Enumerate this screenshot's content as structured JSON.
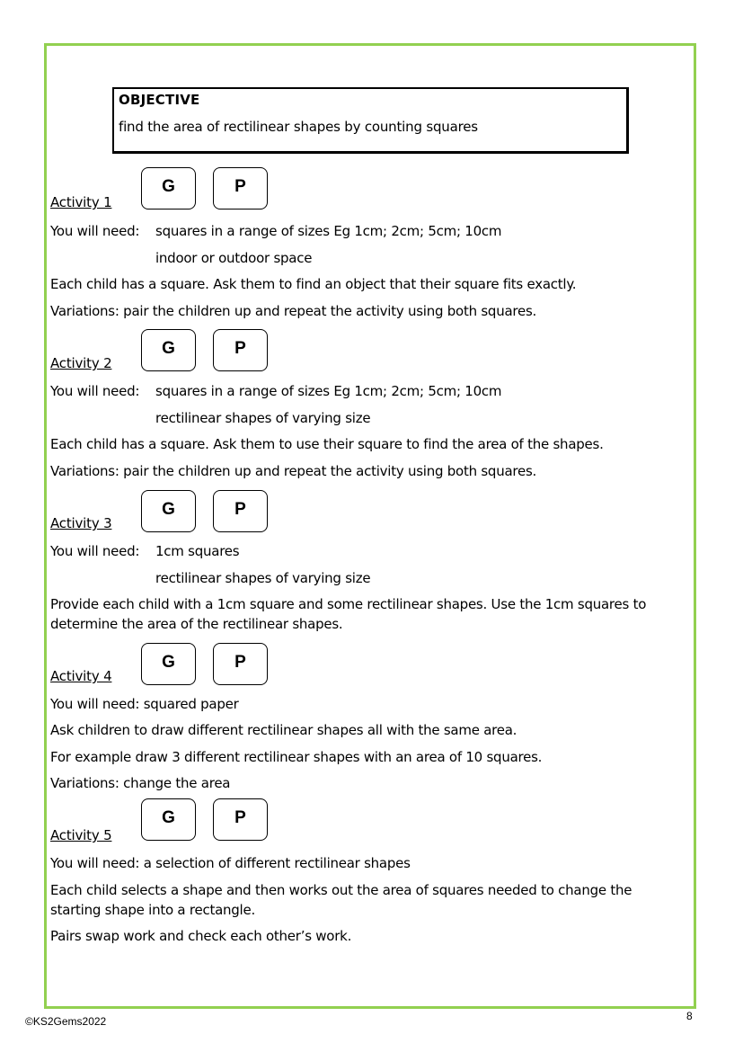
{
  "objective": {
    "title": "OBJECTIVE",
    "text": "find the area of rectilinear shapes by counting squares"
  },
  "badges": {
    "group": "G",
    "pair": "P"
  },
  "activities": [
    {
      "heading": "Activity 1",
      "need_label": "You will need:",
      "need_items": [
        "squares in a range of sizes Eg 1cm; 2cm; 5cm; 10cm",
        "indoor or outdoor space"
      ],
      "instructions": [
        "Each child has a square. Ask them to find an object that their square fits exactly.",
        "Variations: pair the children up and repeat the activity using both squares."
      ]
    },
    {
      "heading": "Activity 2",
      "need_label": "You will need:",
      "need_items": [
        "squares in a range of sizes Eg 1cm; 2cm; 5cm; 10cm",
        "rectilinear shapes of varying size"
      ],
      "instructions": [
        "Each child has a square. Ask them to use their square to find the area of the shapes.",
        "Variations: pair the children up and repeat the activity using both squares."
      ]
    },
    {
      "heading": "Activity 3",
      "need_label": "You will need:",
      "need_items": [
        "1cm squares",
        "rectilinear shapes of varying size"
      ],
      "instructions": [
        "Provide each child with a 1cm square and some rectilinear shapes. Use the 1cm squares to determine the area of the rectilinear shapes."
      ]
    },
    {
      "heading": "Activity 4",
      "need_line": "You will need: squared paper",
      "instructions": [
        "Ask children to draw different rectilinear shapes all with the same area.",
        "For example draw 3 different rectilinear shapes with an area of 10 squares.",
        "Variations: change the area"
      ]
    },
    {
      "heading": "Activity 5",
      "need_line": "You will need: a selection of different rectilinear shapes",
      "instructions": [
        "Each child selects a shape and then works out the area of squares needed to change the starting shape into a rectangle.",
        "Pairs swap work and check each other’s work."
      ]
    }
  ],
  "footer": {
    "copyright": "©KS2Gems2022",
    "page_number": "8"
  },
  "colors": {
    "frame_border": "#92d050"
  }
}
